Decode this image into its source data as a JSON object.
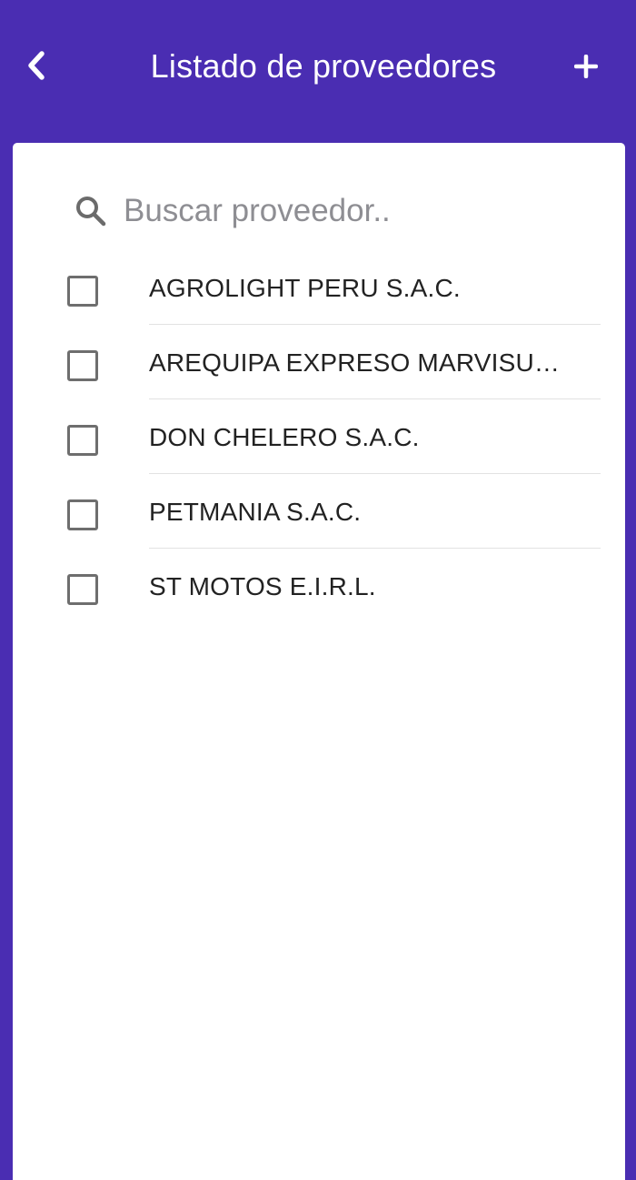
{
  "header": {
    "title": "Listado de proveedores",
    "back_icon": "chevron-left-icon",
    "add_icon": "plus-icon",
    "background_color": "#4a2db2"
  },
  "search": {
    "placeholder": "Buscar proveedor..",
    "value": "",
    "icon": "search-icon"
  },
  "suppliers": [
    {
      "name": "AGROLIGHT PERU S.A.C.",
      "checked": false
    },
    {
      "name": "AREQUIPA EXPRESO MARVISUR …",
      "checked": false
    },
    {
      "name": "DON CHELERO S.A.C.",
      "checked": false
    },
    {
      "name": "PETMANIA S.A.C.",
      "checked": false
    },
    {
      "name": "ST MOTOS E.I.R.L.",
      "checked": false
    }
  ]
}
